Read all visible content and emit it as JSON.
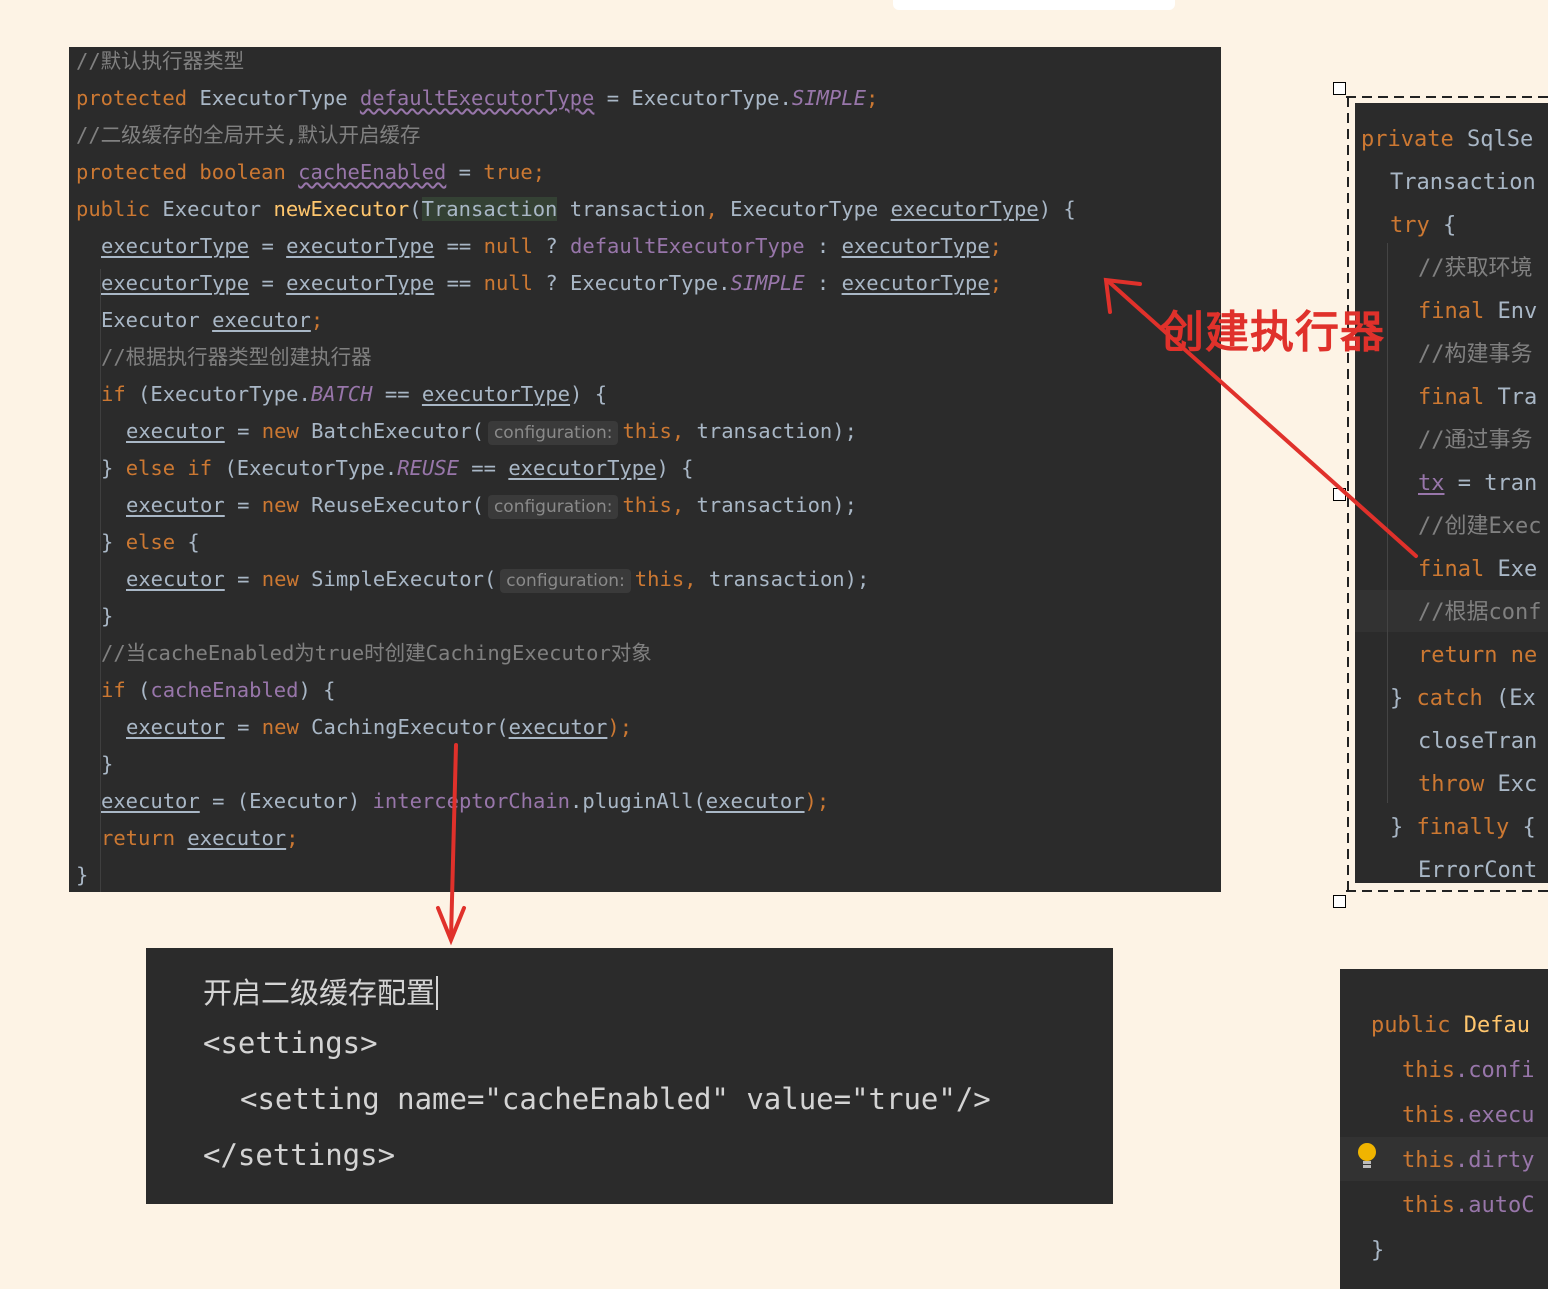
{
  "main_code": {
    "l1": "//默认执行器类型",
    "l2": {
      "kw": "protected",
      "type": "ExecutorType",
      "field": "defaultExecutorType",
      "eq": "=",
      "cls": "ExecutorType.",
      "const": "SIMPLE",
      "semi": ";"
    },
    "l3": "//二级缓存的全局开关,默认开启缓存",
    "l4": {
      "kw": "protected boolean",
      "field": "cacheEnabled",
      "eq": "=",
      "val": "true",
      "semi": ";"
    },
    "l5": {
      "kw": "public",
      "type": "Executor",
      "fn": "newExecutor",
      "open": "(",
      "hl": "Transaction",
      "p1": "transaction",
      "comma": ",",
      "p2type": "ExecutorType",
      "p2": "executorType",
      "close": ") {"
    },
    "l6": {
      "a": "executorType",
      "eq": "=",
      "b": "executorType",
      "op": "==",
      "null": "null",
      "q": "?",
      "def": "defaultExecutorType",
      "colon": ":",
      "c": "executorType",
      "semi": ";"
    },
    "l7": {
      "a": "executorType",
      "eq": "=",
      "b": "executorType",
      "op": "==",
      "null": "null",
      "q": "?",
      "cls": "ExecutorType.",
      "const": "SIMPLE",
      "colon": ":",
      "c": "executorType",
      "semi": ";"
    },
    "l8": {
      "type": "Executor",
      "var": "executor",
      "semi": ";"
    },
    "l9": "//根据执行器类型创建执行器",
    "l10": {
      "kw": "if",
      "open": "(ExecutorType.",
      "const": "BATCH",
      "op": "==",
      "var": "executorType",
      "close": ") {"
    },
    "l11": {
      "var": "executor",
      "eq": "=",
      "kw": "new",
      "cls": "BatchExecutor(",
      "hint": "configuration:",
      "this": "this,",
      "rest": "transaction);"
    },
    "l12": {
      "close": "}",
      "kw": "else if",
      "open": "(ExecutorType.",
      "const": "REUSE",
      "op": "==",
      "var": "executorType",
      "end": ") {"
    },
    "l13": {
      "var": "executor",
      "eq": "=",
      "kw": "new",
      "cls": "ReuseExecutor(",
      "hint": "configuration:",
      "this": "this,",
      "rest": "transaction);"
    },
    "l14": {
      "close": "}",
      "kw": "else",
      "open": "{"
    },
    "l15": {
      "var": "executor",
      "eq": "=",
      "kw": "new",
      "cls": "SimpleExecutor(",
      "hint": "configuration:",
      "this": "this,",
      "rest": "transaction);"
    },
    "l16": "}",
    "l17": "//当cacheEnabled为true时创建CachingExecutor对象",
    "l18": {
      "kw": "if",
      "open": "(",
      "field": "cacheEnabled",
      "close": ") {"
    },
    "l19": {
      "var": "executor",
      "eq": "=",
      "kw": "new",
      "cls": "CachingExecutor(",
      "arg": "executor",
      "end": ");"
    },
    "l20": "}",
    "l21": {
      "var": "executor",
      "eq": "=",
      "cast": "(Executor)",
      "field": "interceptorChain",
      "call": ".pluginAll(",
      "arg": "executor",
      "end": ");"
    },
    "l22": {
      "kw": "return",
      "var": "executor",
      "semi": ";"
    },
    "l23": "}"
  },
  "settings_box": {
    "line1": "开启二级缓存配置",
    "line2": "<settings>",
    "line3": "<setting name=\"cacheEnabled\" value=\"true\"/>",
    "line4": "</settings>"
  },
  "right_code_1": {
    "l1": {
      "kw": "private",
      "rest": "SqlSe"
    },
    "l2": "Transaction",
    "l3": {
      "kw": "try",
      "rest": "{"
    },
    "l4": "//获取环境",
    "l5": {
      "kw": "final",
      "rest": "Env"
    },
    "l6": "//构建事务",
    "l7": {
      "kw": "final",
      "rest": "Tra"
    },
    "l8": "//通过事务",
    "l9": {
      "var": "tx",
      "rest": "= tran"
    },
    "l10": "//创建Exec",
    "l11": {
      "kw": "final",
      "rest": "Exe"
    },
    "l12": "//根据conf",
    "l13": {
      "kw": "return",
      "rest": "ne"
    },
    "l14": {
      "close": "}",
      "kw": "catch",
      "rest": "(Ex"
    },
    "l15": "closeTran",
    "l16": {
      "kw": "throw",
      "rest": "Exc"
    },
    "l17": {
      "close": "}",
      "kw": "finally",
      "rest": "{"
    },
    "l18": "ErrorCont"
  },
  "right_code_2": {
    "l1": {
      "kw": "public",
      "fn": "Defau"
    },
    "l2": {
      "kw": "this",
      "field": ".confi"
    },
    "l3": {
      "kw": "this",
      "field": ".execu"
    },
    "l4": {
      "kw": "this",
      "field": ".dirty"
    },
    "l5": {
      "kw": "this",
      "field": ".autoC"
    },
    "l6": "}"
  },
  "annotation": {
    "label": "创建执行器",
    "color": "#e0312b"
  },
  "colors": {
    "background": "#fdf3e5",
    "editor": "#2b2b2b",
    "keyword": "#cc7832",
    "field": "#9876aa",
    "function": "#ffc66d",
    "comment": "#808080",
    "text": "#a9b7c6"
  }
}
